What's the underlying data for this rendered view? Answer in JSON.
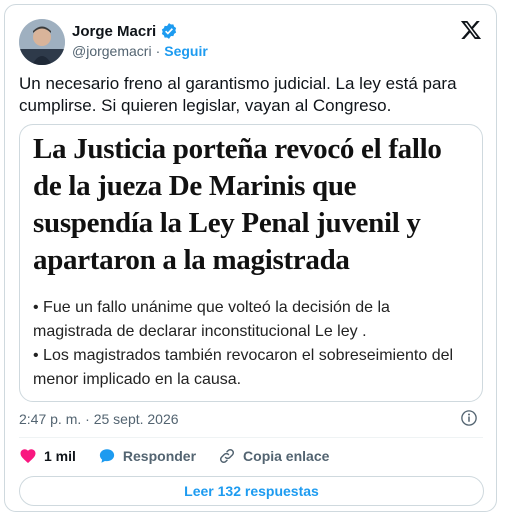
{
  "author": {
    "name": "Jorge Macri",
    "handle": "@jorgemacri",
    "separator": "·",
    "follow_label": "Seguir"
  },
  "tweet": {
    "text": "Un necesario freno al garantismo judicial. La ley está para cumplirse. Si quieren legislar, vayan al Congreso."
  },
  "media": {
    "headline": "La Justicia porteña revocó el fallo de la jueza De Marinis que suspendía la Ley Penal juvenil y apartaron a la magistrada",
    "bullets": [
      "• Fue un fallo unánime que volteó la decisión de la magistrada de declarar inconstitucional Le ley .",
      "• Los magistrados también revocaron el sobreseimiento del menor implicado en la causa."
    ]
  },
  "meta": {
    "timestamp": "2:47 p. m. · 25 sept. 2026"
  },
  "actions": {
    "like_count": "1 mil",
    "reply_label": "Responder",
    "copy_label": "Copia enlace"
  },
  "read_replies_label": "Leer 132 respuestas",
  "colors": {
    "accent": "#1d9bf0",
    "like": "#f91880",
    "muted": "#536471",
    "border": "#cfd9de"
  },
  "icons": [
    "verified-badge-icon",
    "x-logo-icon",
    "info-icon",
    "heart-icon",
    "reply-icon",
    "link-icon"
  ]
}
